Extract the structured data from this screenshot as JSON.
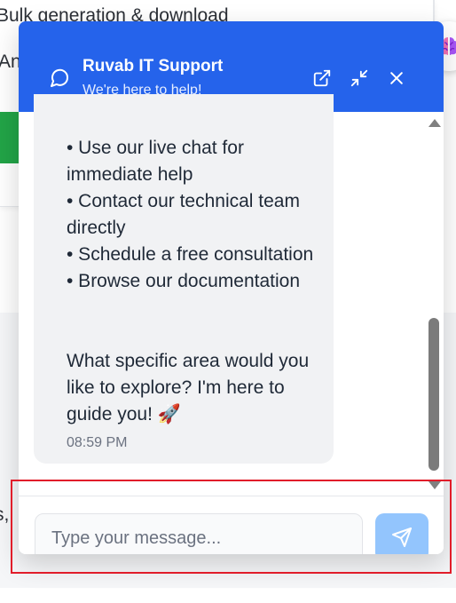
{
  "background": {
    "line1": "Bulk generation & download",
    "line2": "An",
    "line3": "s,"
  },
  "chat": {
    "title": "Ruvab IT Support",
    "subtitle": "We're here to help!",
    "message": {
      "items": [
        "• Use our live chat for immediate help",
        "• Contact our technical team directly",
        "• Schedule a free consultation",
        "• Browse our documentation"
      ],
      "closing": "What specific area would you like to explore? I'm here to guide you! 🚀",
      "time": "08:59 PM"
    },
    "input": {
      "placeholder": "Type your message..."
    }
  },
  "colors": {
    "header": "#2563eb",
    "send_button": "#93c5fd",
    "bubble": "#f1f2f4",
    "highlight": "#e11d2a"
  },
  "icons": [
    "chat-bubble-icon",
    "external-link-icon",
    "minimize-icon",
    "close-icon",
    "send-icon",
    "brain-icon"
  ]
}
